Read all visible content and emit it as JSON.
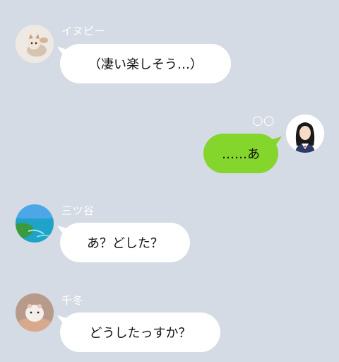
{
  "messages": [
    {
      "sender": "イヌピー",
      "text": "（凄い楽しそう…）",
      "side": "left",
      "avatar": "cat-photo-icon"
    },
    {
      "sender": "",
      "text": "……あ",
      "side": "right",
      "avatar": "schoolgirl-icon",
      "status": "○○"
    },
    {
      "sender": "三ツ谷",
      "text": "あ？どした？",
      "side": "left",
      "avatar": "beach-photo-icon"
    },
    {
      "sender": "千冬",
      "text": "どうしたっすか？",
      "side": "left",
      "avatar": "hamster-photo-icon"
    }
  ],
  "colors": {
    "background": "#d4dbe4",
    "incoming_bubble": "#ffffff",
    "outgoing_bubble": "#84d52c"
  }
}
